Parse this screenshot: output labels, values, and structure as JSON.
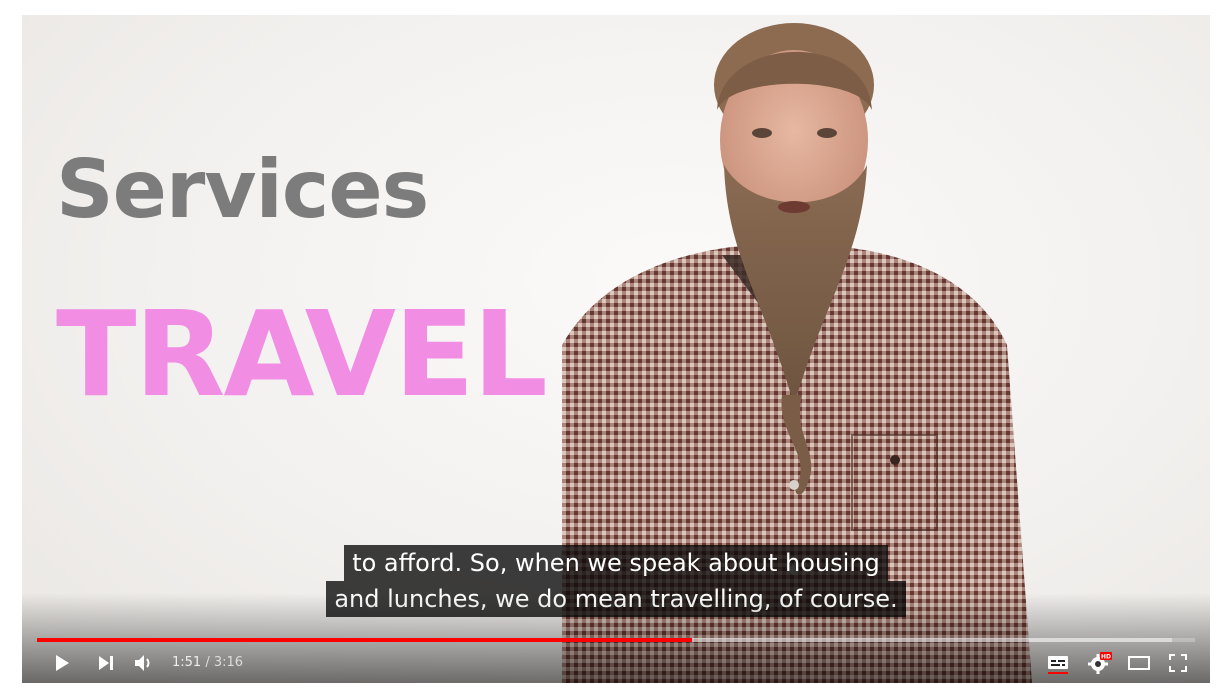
{
  "video": {
    "slide_title": "Services",
    "slide_subtitle": "TRAVEL",
    "colors": {
      "title": "#7c7c7c",
      "subtitle": "#f18ee4",
      "progress_played": "#ff0000"
    }
  },
  "captions": {
    "line1": "to afford. So, when we speak about housing",
    "line2": "and lunches, we do mean travelling, of course."
  },
  "player": {
    "current_time": "1:51",
    "separator": " / ",
    "duration": "3:16",
    "progress_played_fraction": 0.566,
    "progress_loaded_fraction": 0.98,
    "icons": {
      "play": "play-icon",
      "next": "next-icon",
      "volume": "volume-icon",
      "subtitles": "subtitles-icon",
      "settings": "settings-gear-hd-icon",
      "theater": "theater-mode-icon",
      "fullscreen": "fullscreen-icon"
    },
    "settings_badge": "HD"
  }
}
